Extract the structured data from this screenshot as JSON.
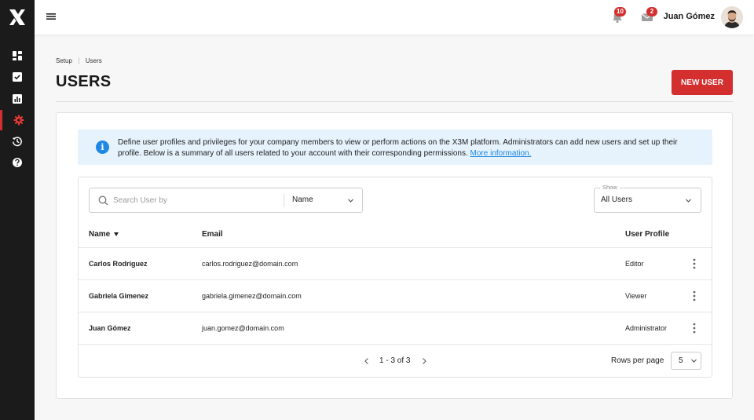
{
  "header": {
    "notifications_count": "10",
    "messages_count": "2",
    "user_name": "Juan Gómez"
  },
  "sidebar": {
    "items": [
      {
        "name": "dashboard-icon"
      },
      {
        "name": "tasks-icon"
      },
      {
        "name": "reports-icon"
      },
      {
        "name": "settings-icon",
        "active": true
      },
      {
        "name": "history-icon"
      },
      {
        "name": "help-icon"
      }
    ]
  },
  "breadcrumb": [
    "Setup",
    "Users"
  ],
  "page": {
    "title": "USERS",
    "new_user_label": "NEW USER"
  },
  "info": {
    "text": "Define user profiles and privileges for your company members to view or perform actions on the X3M platform. Administrators can add new users and set up their profile. Below is a summary of all users related to your account with their corresponding permissions. ",
    "link": "More information."
  },
  "filters": {
    "search_placeholder": "Search User by",
    "search_field": "Name",
    "show_label": "Show",
    "show_value": "All Users"
  },
  "table": {
    "columns": [
      "Name",
      "Email",
      "User Profile"
    ],
    "rows": [
      {
        "name": "Carlos Rodriguez",
        "email": "carlos.rodriguez@domain.com",
        "profile": "Editor"
      },
      {
        "name": "Gabriela Gimenez",
        "email": "gabriela.gimenez@domain.com",
        "profile": "Viewer"
      },
      {
        "name": "Juan Gómez",
        "email": "juan.gomez@domain.com",
        "profile": "Administrator"
      }
    ]
  },
  "pagination": {
    "range": "1 - 3 of 3",
    "rows_per_page_label": "Rows per page",
    "rows_per_page": "5"
  },
  "colors": {
    "accent": "#d32f2f",
    "sidebar": "#1b1b1b",
    "info_bg": "#e6f2fc",
    "link": "#1e88e5"
  }
}
